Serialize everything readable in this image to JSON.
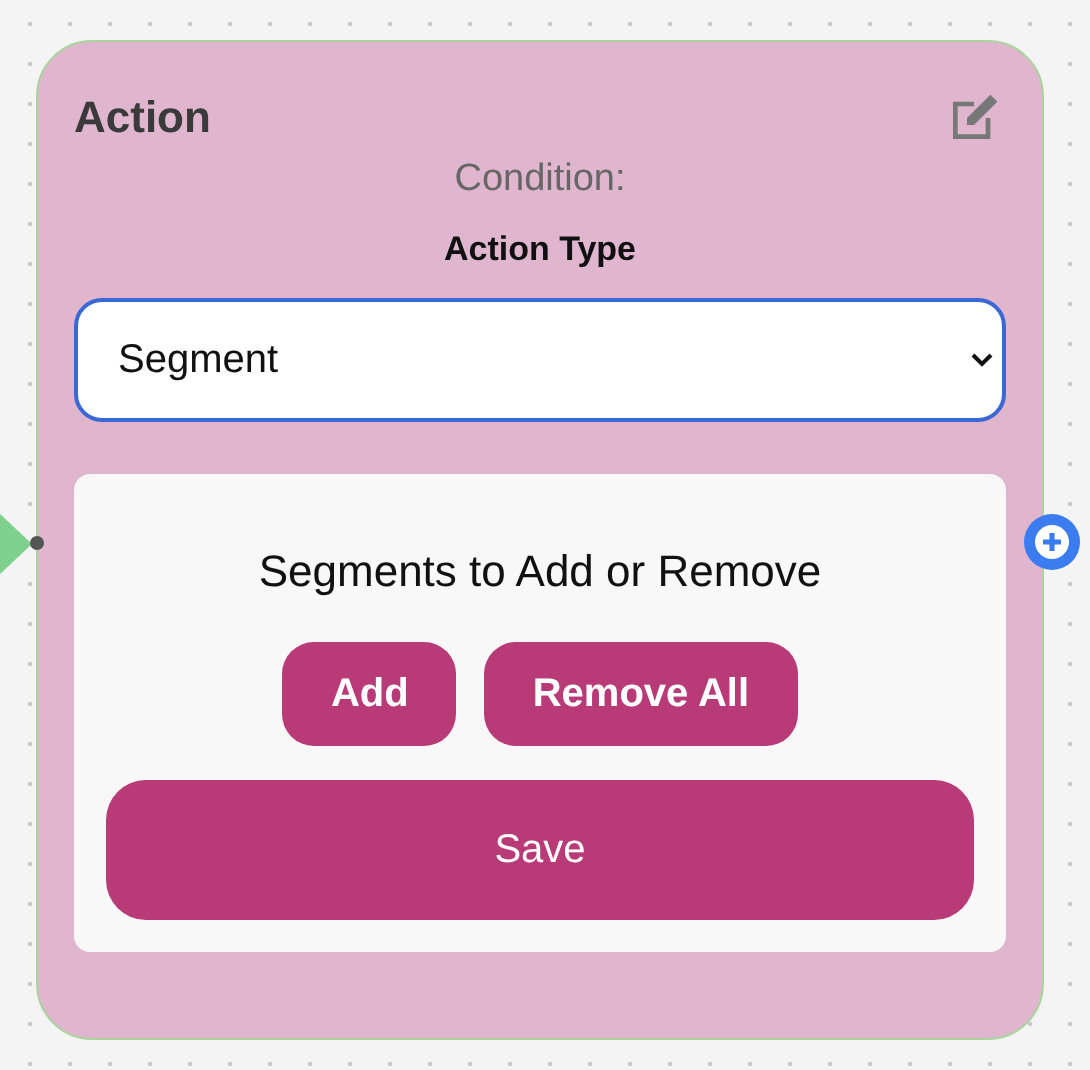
{
  "node": {
    "title": "Action",
    "condition_label": "Condition:",
    "action_type_label": "Action Type",
    "action_type_select": {
      "value": "Segment",
      "focused": true
    },
    "panel": {
      "heading": "Segments to Add or Remove",
      "buttons": [
        "Add",
        "Remove All"
      ],
      "save_button": "Save"
    }
  }
}
